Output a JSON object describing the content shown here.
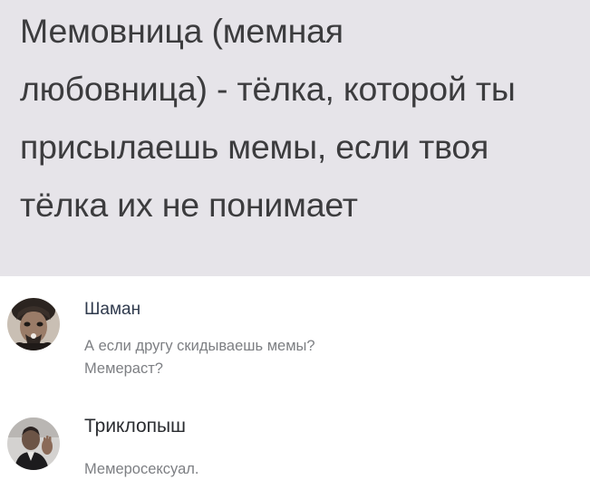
{
  "post": {
    "text_lines": [
      "Мемовница (мемная",
      "любовница) - тёлка, которой ты",
      "присылаешь мемы, если твоя",
      "тёлка их не понимает"
    ]
  },
  "comments": [
    {
      "author": "Шаман",
      "avatar_icon": "user-avatar-icon",
      "text_lines": [
        "А если другу скидываешь мемы?",
        "Мемераст?"
      ]
    },
    {
      "author": "Триклопыш",
      "avatar_icon": "user-avatar-icon",
      "text_lines": [
        "Мемеросексуал."
      ]
    }
  ],
  "colors": {
    "post_background": "#e6e4e9",
    "post_text": "#3c3c3e",
    "author_name": "#2f3a4d",
    "comment_text": "#7d7f83"
  }
}
